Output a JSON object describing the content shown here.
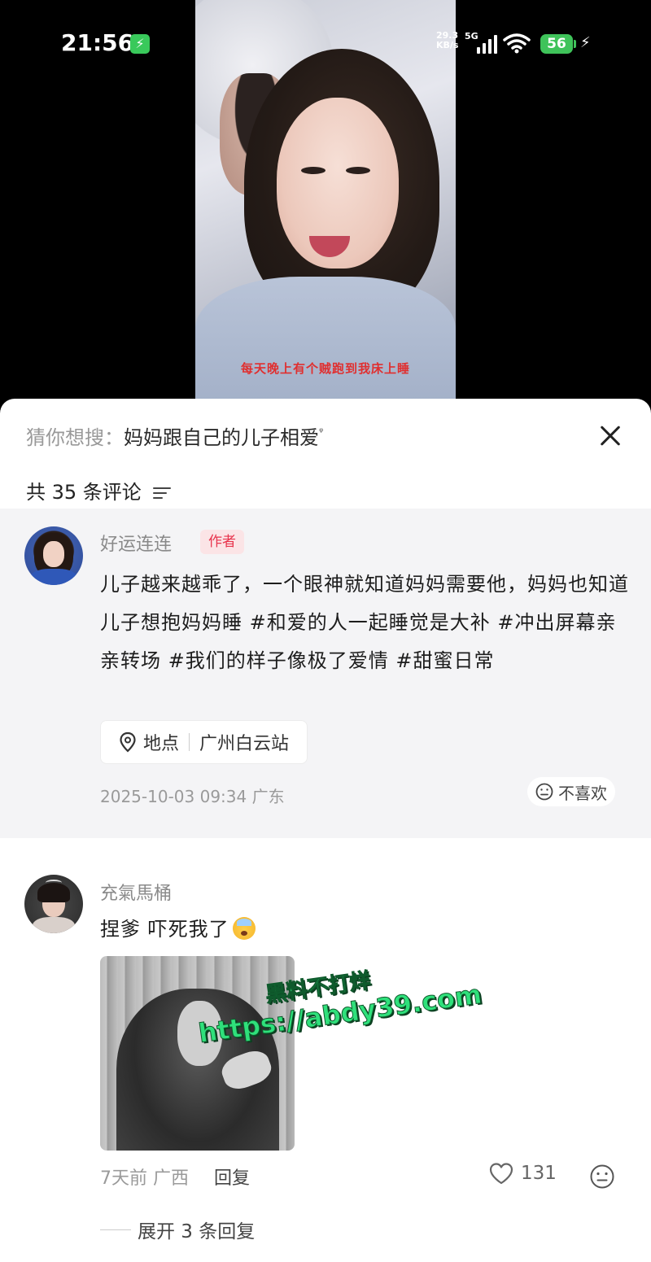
{
  "status_bar": {
    "time": "21:56",
    "charging_badge": "⚡",
    "net_speed_value": "29.3",
    "net_speed_unit": "KB/s",
    "net_type": "5G",
    "battery": "56",
    "bolt": "⚡"
  },
  "video": {
    "caption": "每天晚上有个贼跑到我床上睡"
  },
  "search_suggest": {
    "prefix": "猜你想搜：",
    "query": "妈妈跟自己的儿子相爱",
    "query_icon": "ᵠ"
  },
  "comments_header": {
    "count_label": "共 35 条评论"
  },
  "author_comment": {
    "username": "好运连连",
    "badge": "作者",
    "text": "儿子越来越乖了，一个眼神就知道妈妈需要他，妈妈也知道儿子想抱妈妈睡 #和爱的人一起睡觉是大补 #冲出屏幕亲亲转场 #我们的样子像极了爱情 #甜蜜日常",
    "location_label": "地点",
    "location_value": "广州白云站",
    "timestamp": "2025-10-03 09:34 广东",
    "dislike_label": "不喜欢"
  },
  "comment_2": {
    "username": "充氣馬桶",
    "text": "捏爹 吓死我了",
    "meta": "7天前 广西",
    "reply_label": "回复",
    "likes": "131",
    "expand_label": "展开 3 条回复"
  },
  "watermark": {
    "line1": "黑料不打烊",
    "line2": "https://abdy39.com"
  },
  "icons": {
    "close": "close-icon",
    "sort": "sort-icon",
    "pin": "pin-icon",
    "dislike": "neutral-face-icon",
    "heart": "heart-icon",
    "react": "neutral-face-icon",
    "emoji": "shocked-emoji-icon"
  },
  "colors": {
    "author_badge_text": "#e8334c",
    "author_badge_bg": "#fbe4e6",
    "battery": "#3fc35a",
    "watermark": "#2fe07b"
  }
}
